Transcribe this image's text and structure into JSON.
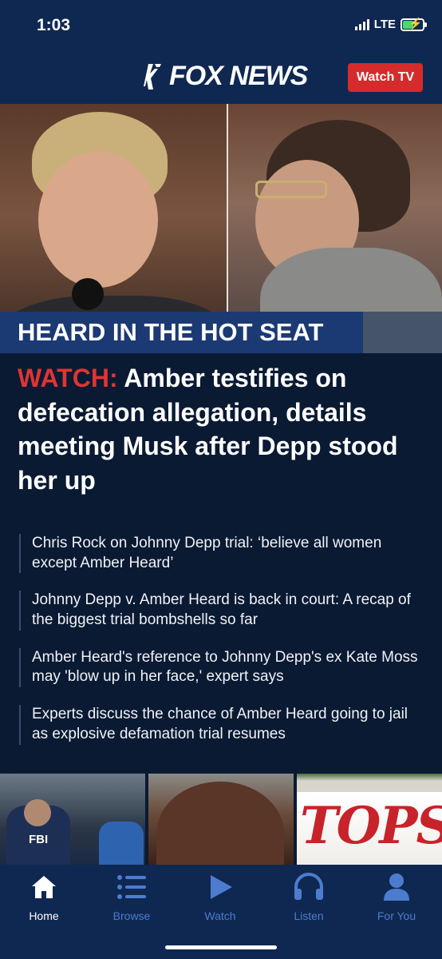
{
  "status_bar": {
    "time": "1:03",
    "network": "LTE"
  },
  "header": {
    "logo_text": "FOX NEWS",
    "watch_tv_label": "Watch TV",
    "watch_tv_color": "#d52b2b"
  },
  "hero": {
    "caption": "HEARD IN THE HOT SEAT",
    "headline_label": "WATCH:",
    "headline_text": " Amber testifies on defecation allegation, details meeting Musk after Depp stood her up"
  },
  "related": [
    "Chris Rock on Johnny Depp trial: ‘believe all women except Amber Heard’",
    "Johnny Depp v. Amber Heard is back in court: A recap of the biggest trial bombshells so far",
    "Amber Heard's reference to Johnny Depp's ex Kate Moss may 'blow up in her face,' expert says",
    "Experts discuss the chance of Amber Heard going to jail as explosive defamation trial resumes"
  ],
  "thumbnails": {
    "fbi_text": "FBI",
    "tops_text": "TOPS"
  },
  "tabs": [
    {
      "label": "Home",
      "icon": "home-icon",
      "active": true
    },
    {
      "label": "Browse",
      "icon": "list-icon",
      "active": false
    },
    {
      "label": "Watch",
      "icon": "play-icon",
      "active": false
    },
    {
      "label": "Listen",
      "icon": "headphones-icon",
      "active": false
    },
    {
      "label": "For You",
      "icon": "person-icon",
      "active": false
    }
  ],
  "colors": {
    "background": "#0a1a33",
    "header": "#0f2851",
    "accent_red": "#e03434",
    "tab_inactive": "#4d7ccf"
  }
}
